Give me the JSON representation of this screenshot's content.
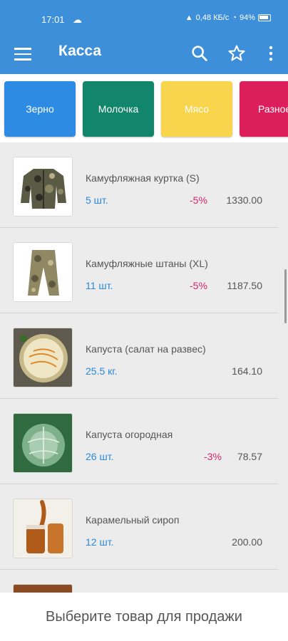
{
  "status_bar": {
    "time": "17:01",
    "battery": "94%",
    "speed": "0,48 КБ/с"
  },
  "toolbar": {
    "title": "Касса"
  },
  "categories": [
    {
      "label": "Зерно",
      "color": "#2e8be3"
    },
    {
      "label": "Молочка",
      "color": "#12866b"
    },
    {
      "label": "Мясо",
      "color": "#f8d54d"
    },
    {
      "label": "Разное",
      "color": "#dc1f5c"
    }
  ],
  "products": [
    {
      "name": "Камуфляжная куртка (S)",
      "qty": "5 шт.",
      "discount": "-5%",
      "price": "1330.00",
      "image": "camo-jacket"
    },
    {
      "name": "Камуфляжные штаны (XL)",
      "qty": "11 шт.",
      "discount": "-5%",
      "price": "1187.50",
      "image": "camo-pants"
    },
    {
      "name": "Капуста (салат на развес)",
      "qty": "25.5 кг.",
      "discount": "",
      "price": "164.10",
      "image": "cabbage-salad"
    },
    {
      "name": "Капуста огородная",
      "qty": "26 шт.",
      "discount": "-3%",
      "price": "78.57",
      "image": "cabbage"
    },
    {
      "name": "Карамельный сироп",
      "qty": "12 шт.",
      "discount": "",
      "price": "200.00",
      "image": "caramel-syrup"
    }
  ],
  "footer": {
    "text": "Выберите товар для продажи"
  },
  "colors": {
    "appbar": "#3d8fd9",
    "quantity": "#2a88d8",
    "discount": "#d6266e"
  }
}
